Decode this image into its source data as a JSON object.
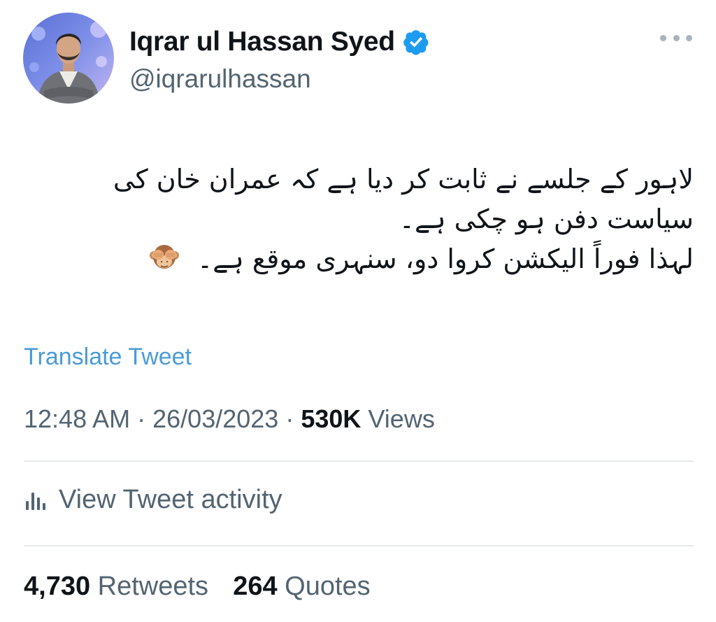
{
  "author": {
    "display_name": "Iqrar ul Hassan Syed",
    "handle": "@iqrarulhassan",
    "verified": true,
    "avatar_icon": "profile-photo"
  },
  "tweet": {
    "lines": [
      "لاہور کے جلسے نے ثابت کر دیا ہے کہ عمران خان کی",
      "سیاست دفن ہو چکی ہے۔",
      "لہذا فوراً الیکشن کروا دو، سنہری موقع ہے۔"
    ],
    "emoji": "see-no-evil-monkey"
  },
  "translate_label": "Translate Tweet",
  "meta": {
    "time": "12:48 AM",
    "date": "26/03/2023",
    "separator": "·",
    "views_count": "530K",
    "views_label": "Views"
  },
  "activity_label": "View Tweet activity",
  "stats": {
    "retweets_count": "4,730",
    "retweets_label": "Retweets",
    "quotes_count": "264",
    "quotes_label": "Quotes"
  },
  "colors": {
    "link": "#4a9bd6",
    "secondary_text": "#536471",
    "primary_text": "#0f1419",
    "verified": "#1d9bf0",
    "divider": "#e6e9ec"
  }
}
